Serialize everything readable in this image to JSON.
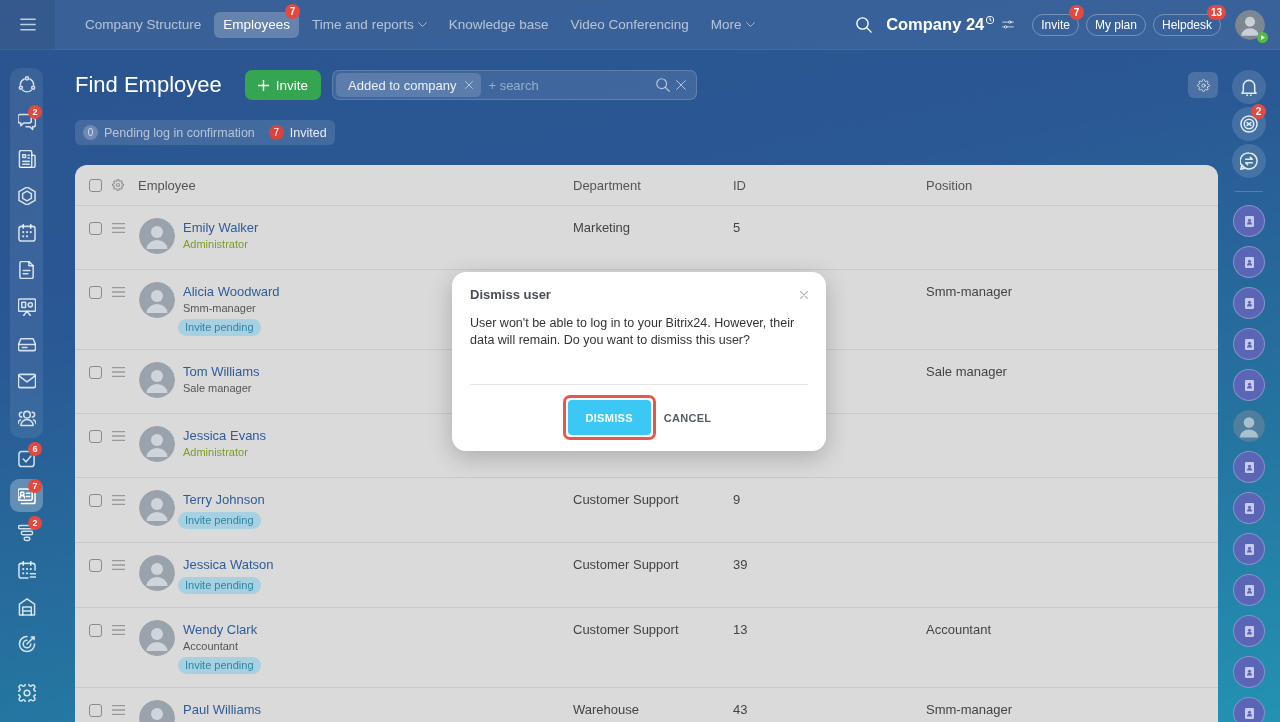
{
  "top_bar": {
    "nav": [
      {
        "label": "Company Structure",
        "selected": false,
        "has_menu": false
      },
      {
        "label": "Employees",
        "selected": true,
        "has_menu": false,
        "badge": "7"
      },
      {
        "label": "Time and reports",
        "selected": false,
        "has_menu": true
      },
      {
        "label": "Knowledge base",
        "selected": false,
        "has_menu": false
      },
      {
        "label": "Video Conferencing",
        "selected": false,
        "has_menu": false
      },
      {
        "label": "More",
        "selected": false,
        "has_menu": true
      }
    ],
    "company": "Company 24",
    "buttons": [
      {
        "label": "Invite",
        "badge": "7"
      },
      {
        "label": "My plan"
      },
      {
        "label": "Helpdesk",
        "badge": "13"
      }
    ]
  },
  "left_sidebar": {
    "pinned_items": [
      {
        "selected": false
      },
      {
        "selected": false,
        "badge": "2"
      },
      {
        "selected": false
      },
      {
        "selected": false
      },
      {
        "selected": false
      },
      {
        "selected": false
      },
      {
        "selected": false
      },
      {
        "selected": false
      },
      {
        "selected": false
      },
      {
        "selected": false
      }
    ],
    "items": [
      {
        "selected": false,
        "badge": "6"
      },
      {
        "selected": true,
        "badge": "7"
      },
      {
        "selected": false,
        "badge": "2"
      },
      {
        "selected": false
      },
      {
        "selected": false
      },
      {
        "selected": false
      },
      {
        "selected": false
      }
    ]
  },
  "page": {
    "title": "Find Employee",
    "invite_button": "Invite",
    "filter": {
      "tags": [
        "Added to company"
      ],
      "placeholder": "+ search"
    },
    "counters": [
      {
        "count": "0",
        "label": "Pending log in confirmation",
        "kind": "neutral"
      },
      {
        "count": "7",
        "label": "Invited",
        "kind": "alert"
      }
    ]
  },
  "table": {
    "select_all": {
      "checked": false
    },
    "columns": [
      "Employee",
      "Department",
      "ID",
      "Position"
    ],
    "rows": [
      {
        "name": "Emily Walker",
        "subtitle": {
          "text": "Administrator",
          "kind": "admin"
        },
        "department": "Marketing",
        "id": "5",
        "checked": false
      },
      {
        "name": "Alicia Woodward",
        "subtitle": {
          "text": "Smm-manager",
          "kind": "position"
        },
        "badge": "Invite pending",
        "position": "Smm-manager",
        "checked": false
      },
      {
        "name": "Tom Williams",
        "subtitle": {
          "text": "Sale manager",
          "kind": "position"
        },
        "position": "Sale manager",
        "checked": false
      },
      {
        "name": "Jessica Evans",
        "subtitle": {
          "text": "Administrator",
          "kind": "admin"
        },
        "checked": false
      },
      {
        "name": "Terry Johnson",
        "badge": "Invite pending",
        "department": "Customer Support",
        "id": "9",
        "checked": false
      },
      {
        "name": "Jessica Watson",
        "badge": "Invite pending",
        "department": "Customer Support",
        "id": "39",
        "checked": false
      },
      {
        "name": "Wendy Clark",
        "subtitle": {
          "text": "Accountant",
          "kind": "position"
        },
        "badge": "Invite pending",
        "department": "Customer Support",
        "id": "13",
        "position": "Accountant",
        "checked": false
      },
      {
        "name": "Paul Williams",
        "department": "Warehouse",
        "id": "43",
        "position": "Smm-manager",
        "checked": false
      }
    ]
  },
  "dialog": {
    "title": "Dismiss user",
    "message": "User won't be able to log in to your Bitrix24. However, their data will remain. Do you want to dismiss this user?",
    "buttons": [
      {
        "label": "DISMISS",
        "kind": "primary",
        "highlighted": true
      },
      {
        "label": "CANCEL",
        "kind": "link",
        "highlighted": false
      }
    ]
  },
  "right_sidebar": {
    "tools": [
      {
        "kind": "bell"
      },
      {
        "kind": "rings",
        "badge": "2"
      },
      {
        "kind": "chat"
      }
    ],
    "contacts": [
      {
        "kind": "placeholder"
      },
      {
        "kind": "placeholder"
      },
      {
        "kind": "placeholder"
      },
      {
        "kind": "placeholder"
      },
      {
        "kind": "placeholder"
      },
      {
        "kind": "photo"
      },
      {
        "kind": "placeholder"
      },
      {
        "kind": "placeholder"
      },
      {
        "kind": "placeholder"
      },
      {
        "kind": "placeholder"
      },
      {
        "kind": "placeholder"
      },
      {
        "kind": "placeholder"
      },
      {
        "kind": "placeholder"
      }
    ]
  }
}
